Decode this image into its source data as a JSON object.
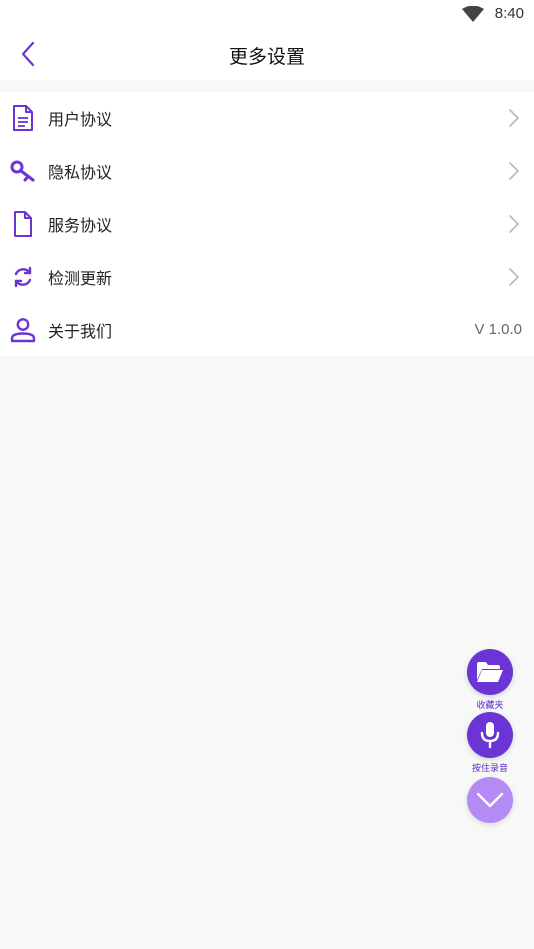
{
  "status_bar": {
    "time": "8:40"
  },
  "header": {
    "title": "更多设置"
  },
  "menu": {
    "items": [
      {
        "label": "用户协议",
        "icon": "document-icon"
      },
      {
        "label": "隐私协议",
        "icon": "key-icon"
      },
      {
        "label": "服务协议",
        "icon": "file-icon"
      },
      {
        "label": "检测更新",
        "icon": "refresh-icon"
      },
      {
        "label": "关于我们",
        "icon": "user-icon",
        "value": "V 1.0.0"
      }
    ]
  },
  "floating": {
    "favorites_label": "收藏夹",
    "record_label": "按住录音"
  },
  "colors": {
    "accent": "#6a35d4",
    "accent_light": "#b48af5",
    "background": "#f8f8f8"
  }
}
